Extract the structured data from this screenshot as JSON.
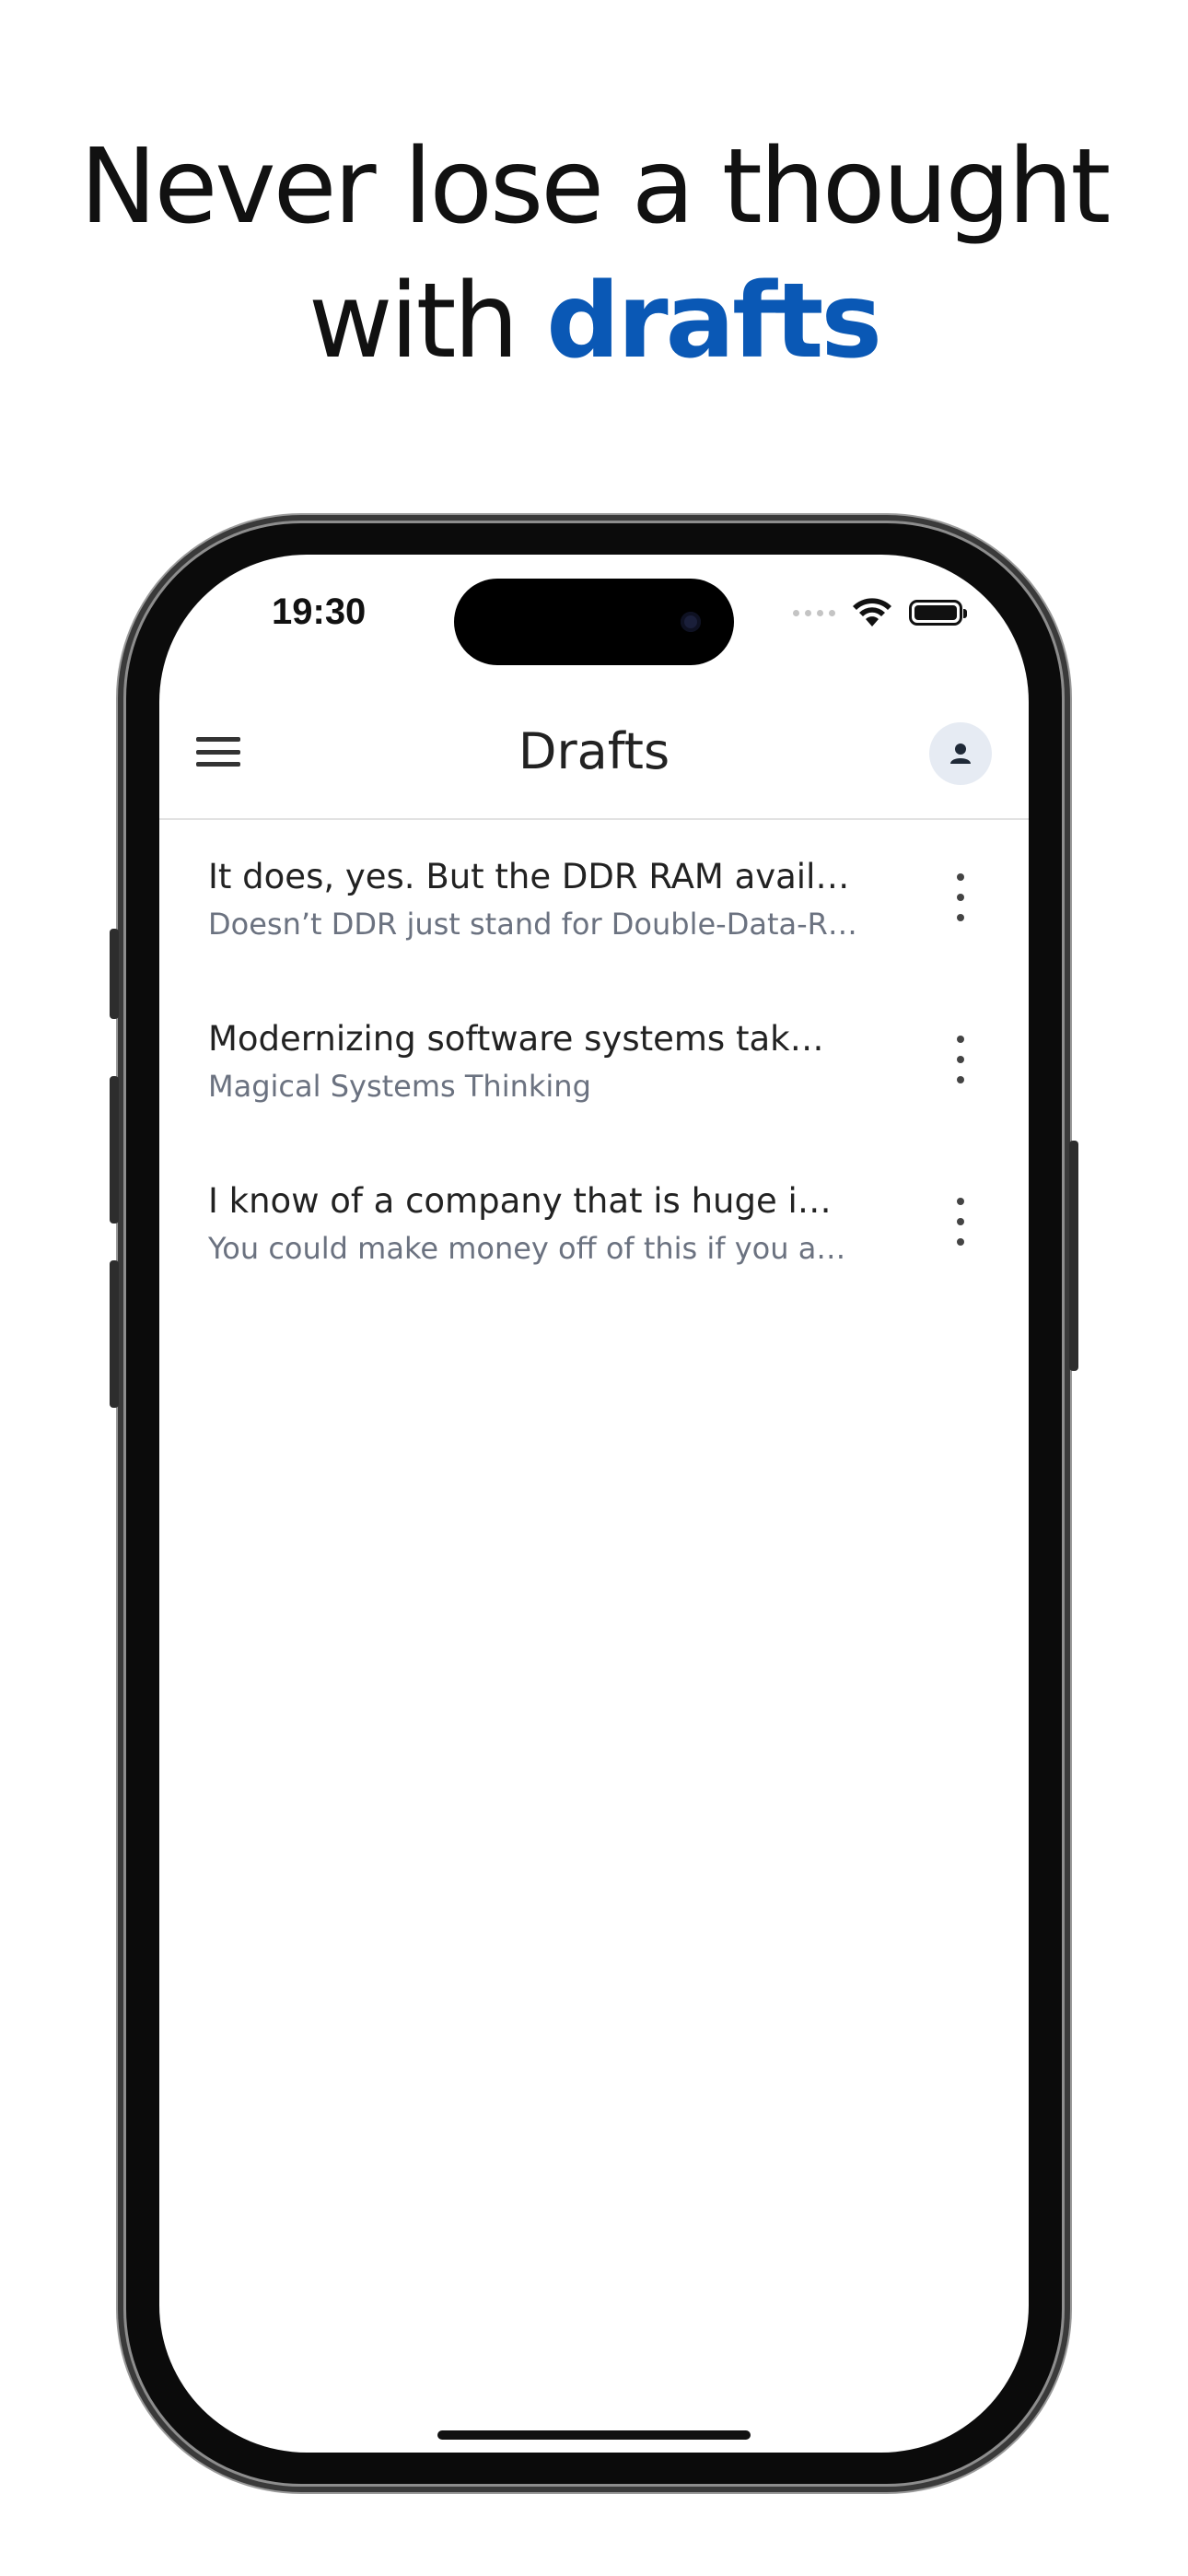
{
  "headline": {
    "line1": "Never lose a thought",
    "line2_prefix": "with ",
    "line2_accent": "drafts"
  },
  "status_bar": {
    "time": "19:30"
  },
  "app_bar": {
    "title": "Drafts"
  },
  "drafts": [
    {
      "title": "It does, yes. But the DDR RAM avail…",
      "subtitle": "Doesn’t DDR just stand for Double-Data-R…"
    },
    {
      "title": "Modernizing software systems tak…",
      "subtitle": "Magical Systems Thinking"
    },
    {
      "title": "I know of a company that is huge i…",
      "subtitle": "You could make money off of this if you a…"
    }
  ],
  "colors": {
    "accent": "#0a58b5",
    "subtitle": "#6b7280",
    "avatar_bg": "#e6ebf3"
  },
  "icons": {
    "menu": "hamburger-menu-icon",
    "account": "person-icon",
    "more": "more-vert-icon",
    "wifi": "wifi-icon",
    "battery": "battery-icon"
  }
}
